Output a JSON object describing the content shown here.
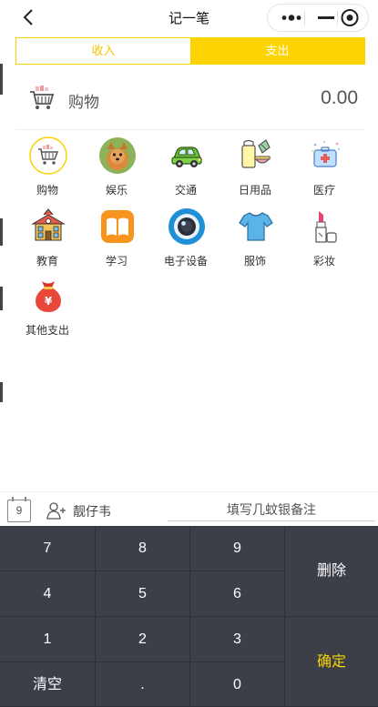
{
  "nav": {
    "title": "记一笔"
  },
  "tabs": [
    {
      "label": "收入",
      "active": false
    },
    {
      "label": "支出",
      "active": true
    }
  ],
  "amount_row": {
    "category": "购物",
    "amount": "0.00"
  },
  "categories": [
    {
      "label": "购物",
      "icon": "shopping-cart-icon",
      "selected": true
    },
    {
      "label": "娱乐",
      "icon": "dog-photo-icon"
    },
    {
      "label": "交通",
      "icon": "car-icon"
    },
    {
      "label": "日用品",
      "icon": "daily-goods-icon"
    },
    {
      "label": "医疗",
      "icon": "medical-kit-icon"
    },
    {
      "label": "教育",
      "icon": "school-icon"
    },
    {
      "label": "学习",
      "icon": "book-icon"
    },
    {
      "label": "电子设备",
      "icon": "camera-lens-icon"
    },
    {
      "label": "服饰",
      "icon": "tshirt-icon"
    },
    {
      "label": "彩妆",
      "icon": "lipstick-icon"
    },
    {
      "label": "其他支出",
      "icon": "money-bag-icon"
    }
  ],
  "bottom_bar": {
    "date_day": "9",
    "member": "靓仔韦",
    "remark_placeholder": "填写几蚊银备注"
  },
  "keypad": {
    "keys": [
      "7",
      "8",
      "9",
      "4",
      "5",
      "6",
      "1",
      "2",
      "3",
      "清空",
      ".",
      "0"
    ],
    "delete_label": "删除",
    "confirm_label": "确定"
  },
  "colors": {
    "accent": "#fdd300",
    "keypad_bg": "#3c3f48",
    "confirm_text": "#f5d400"
  }
}
